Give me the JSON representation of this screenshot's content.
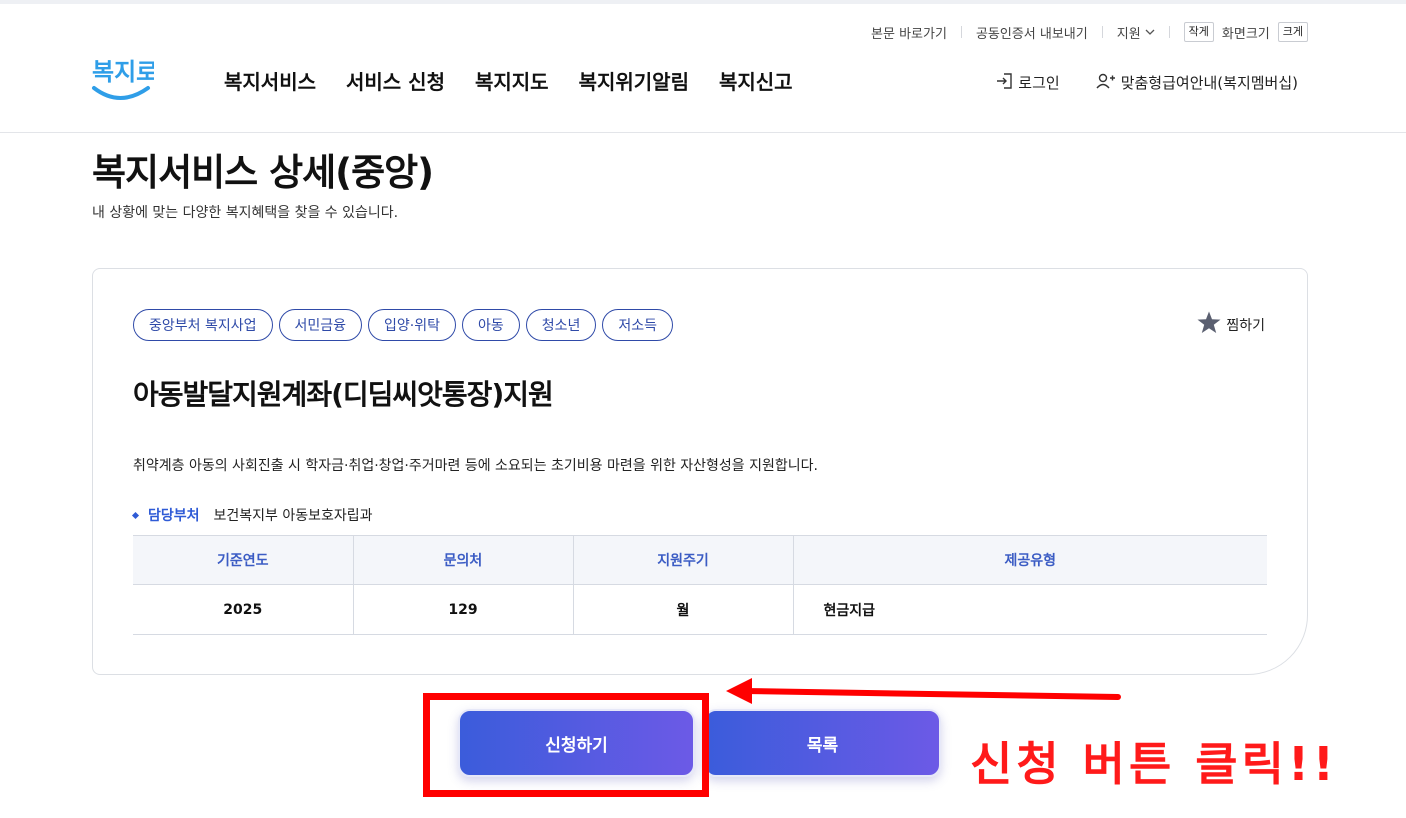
{
  "utility_bar": {
    "skip_link": "본문 바로가기",
    "cert_export": "공동인증서 내보내기",
    "support": "지원",
    "size_small": "작게",
    "size_label": "화면크기",
    "size_large": "크게"
  },
  "logo": {
    "text": "복지로",
    "color": "#2f9ee8"
  },
  "gnb": {
    "items": [
      "복지서비스",
      "서비스 신청",
      "복지지도",
      "복지위기알림",
      "복지신고"
    ]
  },
  "account": {
    "login": "로그인",
    "membership": "맞춤형급여안내(복지멤버십)"
  },
  "page": {
    "title": "복지서비스 상세(중앙)",
    "subtitle": "내 상황에 맞는 다양한 복지혜택을 찾을 수 있습니다."
  },
  "service": {
    "tags": [
      "중앙부처 복지사업",
      "서민금융",
      "입양·위탁",
      "아동",
      "청소년",
      "저소득"
    ],
    "bookmark_label": "찜하기",
    "title": "아동발달지원계좌(디딤씨앗통장)지원",
    "description": "취약계층 아동의 사회진출 시 학자금·취업·창업·주거마련 등에 소요되는 초기비용 마련을 위한 자산형성을 지원합니다.",
    "dept_label": "담당부처",
    "dept_value": "보건복지부 아동보호자립과",
    "table": {
      "headers": [
        "기준연도",
        "문의처",
        "지원주기",
        "제공유형"
      ],
      "row": [
        "2025",
        "129",
        "월",
        "현금지급"
      ]
    }
  },
  "buttons": {
    "apply": "신청하기",
    "list": "목록"
  },
  "annotation": {
    "text": "신청 버튼 클릭!!",
    "color": "#ff0000"
  },
  "colors": {
    "accent": "#2f4aa8",
    "button_gradient_start": "#3b5cdb",
    "button_gradient_end": "#6c5ae6"
  }
}
